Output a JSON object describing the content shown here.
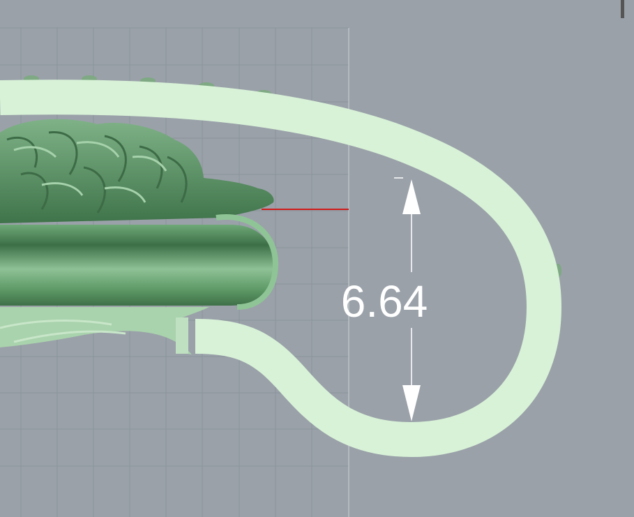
{
  "viewport": {
    "background_color": "#9aa1a9",
    "grid_color": "#8b929b",
    "model_color": "#5f9a68",
    "curve_color": "#d8f2d7",
    "marker_color": "#d11a1a"
  },
  "dimension": {
    "value_label": "6.64"
  }
}
